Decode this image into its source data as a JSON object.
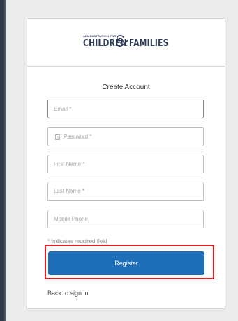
{
  "logo": {
    "small_text": "ADMINISTRATION FOR",
    "word_left": "CHILDREN",
    "word_right": "FAMILIES",
    "brand_color": "#2d3a56"
  },
  "form": {
    "title": "Create Account",
    "email_placeholder": "Email *",
    "password_placeholder": "Password *",
    "first_name_placeholder": "First Name *",
    "last_name_placeholder": "Last Name *",
    "mobile_phone_placeholder": "Mobile Phone",
    "required_hint": "* indicates required field",
    "register_label": "Register",
    "back_link": "Back to sign in"
  },
  "icons": {
    "password_field": "lock-icon",
    "logo_mark": "ampersand-icon"
  },
  "colors": {
    "primary_button": "#1f6fb8",
    "highlight_outline": "#e02020"
  }
}
